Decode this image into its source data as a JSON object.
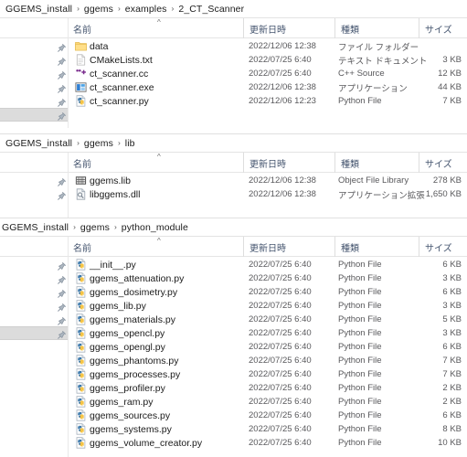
{
  "window": {
    "type": "windows-file-explorer-details-view",
    "background": "#ffffff",
    "header_text_color": "#44546e",
    "body_text_color": "#1b1b1b",
    "secondary_text_color": "#59595c"
  },
  "columns": {
    "name": "名前",
    "date": "更新日時",
    "type": "種類",
    "size": "サイズ",
    "sort_caret": "^"
  },
  "panels": [
    {
      "id": "panel-ct-scanner",
      "breadcrumb": [
        "GGEMS_install",
        "ggems",
        "examples",
        "2_CT_Scanner"
      ],
      "separator": "›",
      "rows": [
        {
          "icon": "folder-icon",
          "name": "data",
          "date": "2022/12/06 12:38",
          "type": "ファイル フォルダー",
          "size": ""
        },
        {
          "icon": "text-file-icon",
          "name": "CMakeLists.txt",
          "date": "2022/07/25 6:40",
          "type": "テキスト ドキュメント",
          "size": "3 KB"
        },
        {
          "icon": "cpp-source-icon",
          "name": "ct_scanner.cc",
          "date": "2022/07/25 6:40",
          "type": "C++ Source",
          "size": "12 KB"
        },
        {
          "icon": "application-icon",
          "name": "ct_scanner.exe",
          "date": "2022/12/06 12:38",
          "type": "アプリケーション",
          "size": "44 KB"
        },
        {
          "icon": "python-file-icon",
          "name": "ct_scanner.py",
          "date": "2022/12/06 12:23",
          "type": "Python File",
          "size": "7 KB"
        }
      ],
      "pin_count": 6,
      "selected_gutter_index": 5
    },
    {
      "id": "panel-lib",
      "breadcrumb": [
        "GGEMS_install",
        "ggems",
        "lib"
      ],
      "separator": "›",
      "rows": [
        {
          "icon": "library-file-icon",
          "name": "ggems.lib",
          "date": "2022/12/06 12:38",
          "type": "Object File Library",
          "size": "278 KB"
        },
        {
          "icon": "dll-file-icon",
          "name": "libggems.dll",
          "date": "2022/12/06 12:38",
          "type": "アプリケーション拡張",
          "size": "1,650 KB"
        }
      ],
      "pin_count": 2,
      "selected_gutter_index": -1
    },
    {
      "id": "panel-python-module",
      "breadcrumb": [
        "GGEMS_install",
        "ggems",
        "python_module"
      ],
      "separator": "›",
      "rows": [
        {
          "icon": "python-file-icon",
          "name": "__init__.py",
          "date": "2022/07/25 6:40",
          "type": "Python File",
          "size": "6 KB"
        },
        {
          "icon": "python-file-icon",
          "name": "ggems_attenuation.py",
          "date": "2022/07/25 6:40",
          "type": "Python File",
          "size": "3 KB"
        },
        {
          "icon": "python-file-icon",
          "name": "ggems_dosimetry.py",
          "date": "2022/07/25 6:40",
          "type": "Python File",
          "size": "6 KB"
        },
        {
          "icon": "python-file-icon",
          "name": "ggems_lib.py",
          "date": "2022/07/25 6:40",
          "type": "Python File",
          "size": "3 KB"
        },
        {
          "icon": "python-file-icon",
          "name": "ggems_materials.py",
          "date": "2022/07/25 6:40",
          "type": "Python File",
          "size": "5 KB"
        },
        {
          "icon": "python-file-icon",
          "name": "ggems_opencl.py",
          "date": "2022/07/25 6:40",
          "type": "Python File",
          "size": "3 KB"
        },
        {
          "icon": "python-file-icon",
          "name": "ggems_opengl.py",
          "date": "2022/07/25 6:40",
          "type": "Python File",
          "size": "6 KB"
        },
        {
          "icon": "python-file-icon",
          "name": "ggems_phantoms.py",
          "date": "2022/07/25 6:40",
          "type": "Python File",
          "size": "7 KB"
        },
        {
          "icon": "python-file-icon",
          "name": "ggems_processes.py",
          "date": "2022/07/25 6:40",
          "type": "Python File",
          "size": "7 KB"
        },
        {
          "icon": "python-file-icon",
          "name": "ggems_profiler.py",
          "date": "2022/07/25 6:40",
          "type": "Python File",
          "size": "2 KB"
        },
        {
          "icon": "python-file-icon",
          "name": "ggems_ram.py",
          "date": "2022/07/25 6:40",
          "type": "Python File",
          "size": "2 KB"
        },
        {
          "icon": "python-file-icon",
          "name": "ggems_sources.py",
          "date": "2022/07/25 6:40",
          "type": "Python File",
          "size": "6 KB"
        },
        {
          "icon": "python-file-icon",
          "name": "ggems_systems.py",
          "date": "2022/07/25 6:40",
          "type": "Python File",
          "size": "8 KB"
        },
        {
          "icon": "python-file-icon",
          "name": "ggems_volume_creator.py",
          "date": "2022/07/25 6:40",
          "type": "Python File",
          "size": "10 KB"
        }
      ],
      "pin_count": 6,
      "selected_gutter_index": 5
    }
  ]
}
